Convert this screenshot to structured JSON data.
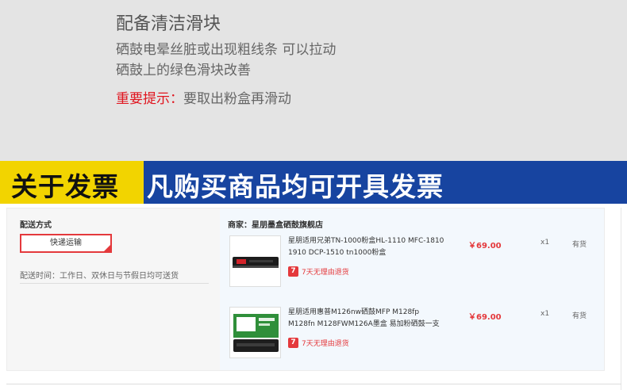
{
  "promo": {
    "title": "配备清洁滑块",
    "line1": "硒鼓电晕丝脏或出现粗线条 可以拉动",
    "line2": "硒鼓上的绿色滑块改善",
    "tip_label": "重要提示：",
    "tip_text": "要取出粉盒再滑动"
  },
  "banner": {
    "left_text": "关于发票",
    "right_text": "凡购买商品均可开具发票",
    "left_color": "#f2d400",
    "right_color": "#1744a0"
  },
  "shipping": {
    "label": "配送方式",
    "method": "快递运输",
    "time": "配送时间：工作日、双休日与节假日均可送货"
  },
  "shop": {
    "name": "商家：星朋墨盒硒鼓旗舰店"
  },
  "items": [
    {
      "name": "星朋适用兄弟TN-1000粉盒HL-1110 MFC-1810 1910 DCP-1510 tn1000粉盒",
      "return_badge": "7",
      "return_text": "7天无理由退货",
      "price": "￥69.00",
      "qty": "x1",
      "stock": "有货",
      "thumb_icon": "toner-cartridge-icon"
    },
    {
      "name": "星朋适用惠普M126nw硒鼓MFP M128fp M128fn M128FWM126A墨盒 易加粉硒鼓一支",
      "return_badge": "7",
      "return_text": "7天无理由退货",
      "price": "￥69.00",
      "qty": "x1",
      "stock": "有货",
      "thumb_icon": "toner-box-icon"
    }
  ],
  "colors": {
    "accent_red": "#e4393c",
    "tip_red": "#e0141e",
    "promo_bg": "#e4e4e4",
    "goods_bg": "#f3f8fd"
  }
}
